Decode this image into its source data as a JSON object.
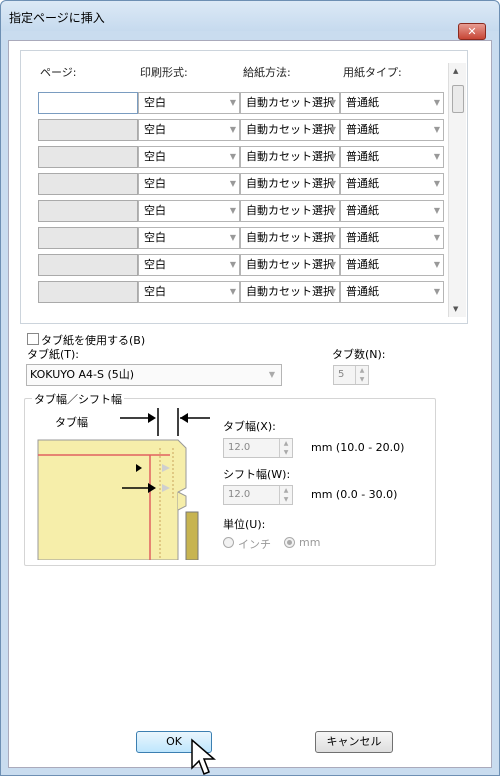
{
  "window": {
    "title": "指定ページに挿入",
    "close": "✕"
  },
  "table": {
    "headers": [
      "ページ:",
      "印刷形式:",
      "給紙方法:",
      "用紙タイプ:"
    ],
    "rows": [
      {
        "page": "",
        "print": "空白",
        "feed": "自動カセット選択",
        "paper": "普通紙"
      },
      {
        "page": "",
        "print": "空白",
        "feed": "自動カセット選択",
        "paper": "普通紙"
      },
      {
        "page": "",
        "print": "空白",
        "feed": "自動カセット選択",
        "paper": "普通紙"
      },
      {
        "page": "",
        "print": "空白",
        "feed": "自動カセット選択",
        "paper": "普通紙"
      },
      {
        "page": "",
        "print": "空白",
        "feed": "自動カセット選択",
        "paper": "普通紙"
      },
      {
        "page": "",
        "print": "空白",
        "feed": "自動カセット選択",
        "paper": "普通紙"
      },
      {
        "page": "",
        "print": "空白",
        "feed": "自動カセット選択",
        "paper": "普通紙"
      },
      {
        "page": "",
        "print": "空白",
        "feed": "自動カセット選択",
        "paper": "普通紙"
      }
    ]
  },
  "tab_paper": {
    "use_label": "タブ紙を使用する(B)",
    "paper_label": "タブ紙(T):",
    "paper_value": "KOKUYO A4-S (5山)",
    "count_label": "タブ数(N):",
    "count_value": "5"
  },
  "tab_width_group": {
    "title": "タブ幅／シフト幅",
    "diagram_label": "タブ幅",
    "tab_width_label": "タブ幅(X):",
    "tab_width_value": "12.0",
    "tab_width_range": "mm (10.0 - 20.0)",
    "shift_width_label": "シフト幅(W):",
    "shift_width_value": "12.0",
    "shift_width_range": "mm (0.0 - 30.0)",
    "unit_label": "単位(U):",
    "unit_inch": "インチ",
    "unit_mm": "mm"
  },
  "buttons": {
    "ok": "OK",
    "cancel": "キャンセル"
  }
}
